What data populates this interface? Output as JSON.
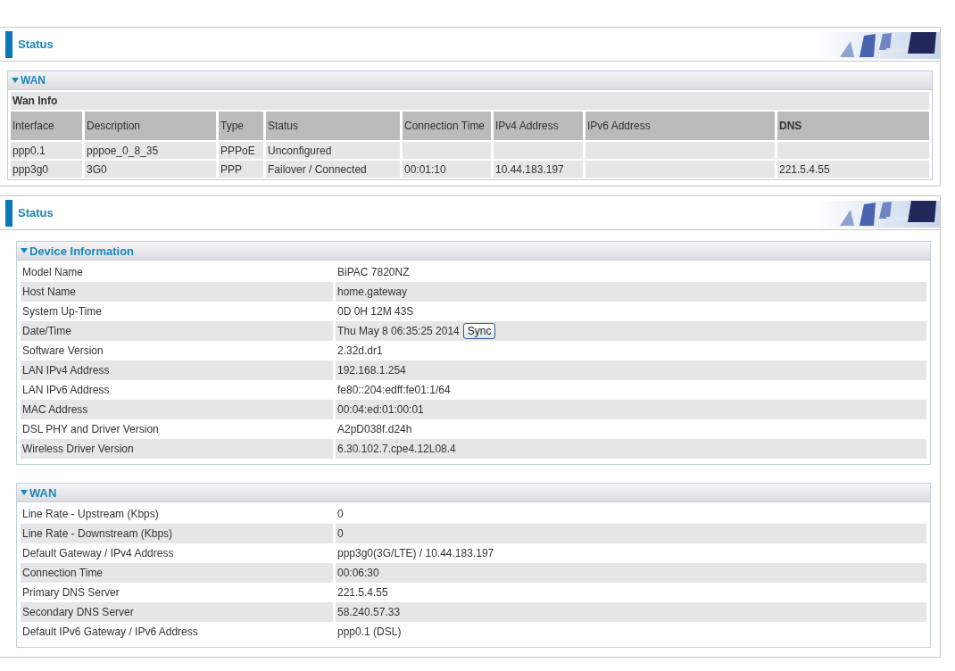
{
  "panels": [
    {
      "title": "Status",
      "sections": [
        {
          "title": "WAN",
          "expanded": true,
          "kind": "table",
          "caption": "Wan Info",
          "columns": [
            {
              "label": "Interface",
              "bold": false
            },
            {
              "label": "Description",
              "bold": false
            },
            {
              "label": "Type",
              "bold": false
            },
            {
              "label": "Status",
              "bold": false
            },
            {
              "label": "Connection Time",
              "bold": false
            },
            {
              "label": "IPv4 Address",
              "bold": false
            },
            {
              "label": "IPv6 Address",
              "bold": false
            },
            {
              "label": "DNS",
              "bold": true
            }
          ],
          "rows": [
            [
              "ppp0.1",
              "pppoe_0_8_35",
              "PPPoE",
              "Unconfigured",
              "",
              "",
              "",
              ""
            ],
            [
              "ppp3g0",
              "3G0",
              "PPP",
              "Failover / Connected",
              "00:01:10",
              "10.44.183.197",
              "",
              "221.5.4.55"
            ]
          ]
        }
      ]
    },
    {
      "title": "Status",
      "sections": [
        {
          "title": "Device Information",
          "expanded": true,
          "kind": "pairs",
          "rows": [
            {
              "label": "Model Name",
              "value": "BiPAC 7820NZ"
            },
            {
              "label": "Host Name",
              "value": "home.gateway"
            },
            {
              "label": "System Up-Time",
              "value": "0D 0H 12M 43S"
            },
            {
              "label": "Date/Time",
              "value": "Thu May 8 06:35:25 2014",
              "button": "Sync"
            },
            {
              "label": "Software Version",
              "value": "2.32d.dr1"
            },
            {
              "label": "LAN IPv4 Address",
              "value": "192.168.1.254"
            },
            {
              "label": "LAN IPv6 Address",
              "value": "fe80::204:edff:fe01:1/64"
            },
            {
              "label": "MAC Address",
              "value": "00:04:ed:01:00:01"
            },
            {
              "label": "DSL PHY and Driver Version",
              "value": "A2pD038f.d24h"
            },
            {
              "label": "Wireless Driver Version",
              "value": "6.30.102.7.cpe4.12L08.4"
            }
          ]
        },
        {
          "title": "WAN",
          "expanded": true,
          "kind": "pairs",
          "rows": [
            {
              "label": "Line Rate - Upstream (Kbps)",
              "value": "0"
            },
            {
              "label": "Line Rate - Downstream (Kbps)",
              "value": "0"
            },
            {
              "label": "Default Gateway / IPv4 Address",
              "value": "ppp3g0(3G/LTE) / 10.44.183.197"
            },
            {
              "label": "Connection Time",
              "value": "00:06:30"
            },
            {
              "label": "Primary DNS Server",
              "value": "221.5.4.55"
            },
            {
              "label": "Secondary DNS Server",
              "value": "58.240.57.33"
            },
            {
              "label": "Default IPv6 Gateway / IPv6 Address",
              "value": "ppp0.1 (DSL)"
            }
          ]
        }
      ]
    }
  ]
}
